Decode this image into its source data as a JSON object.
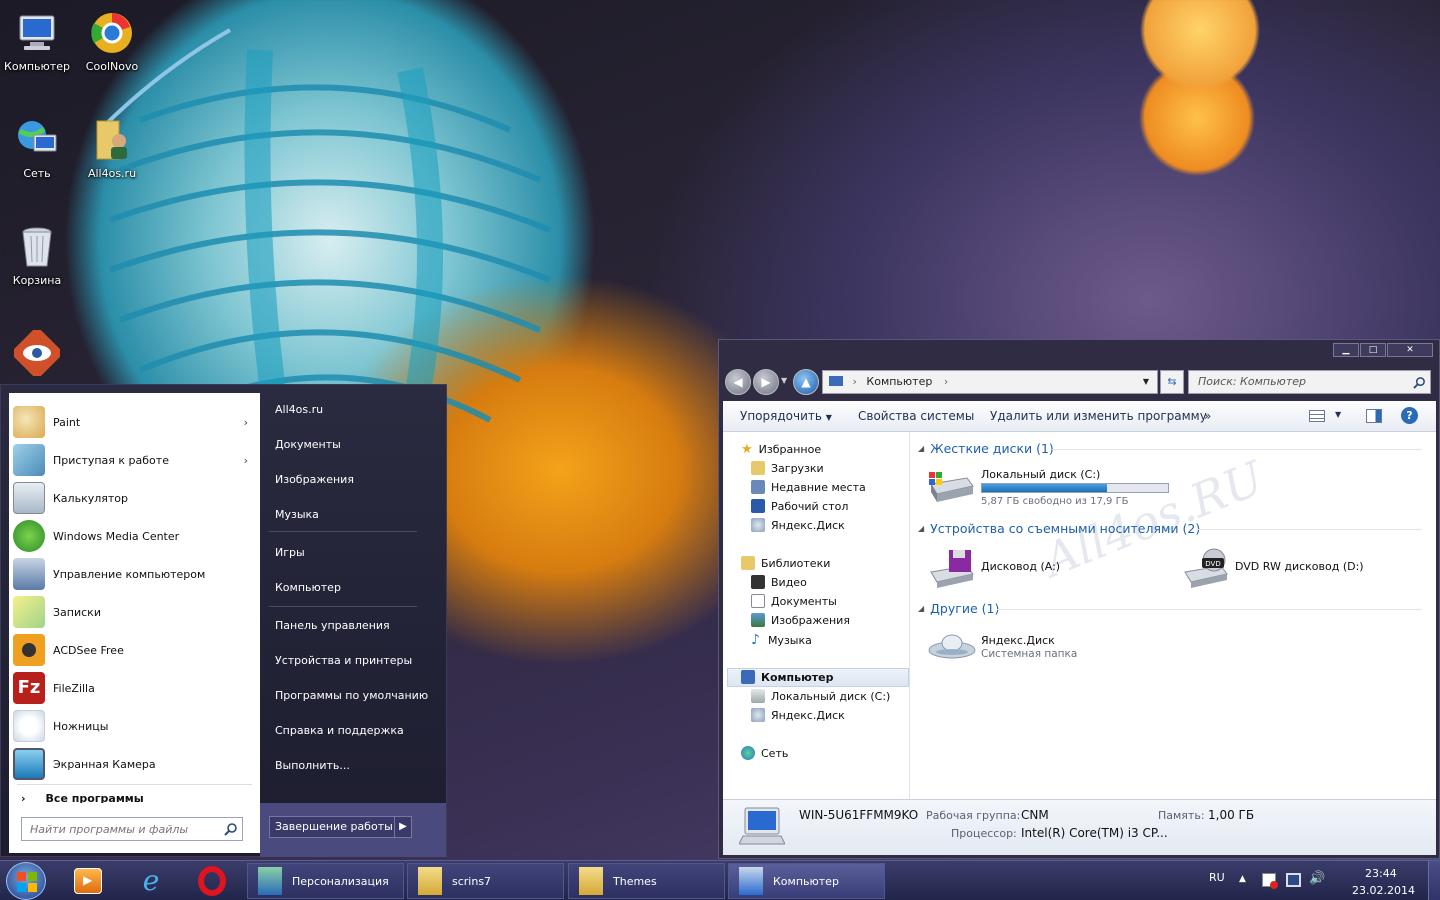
{
  "desktop": {
    "icons": [
      {
        "label": "Компьютер"
      },
      {
        "label": "CoolNovo"
      },
      {
        "label": "Сеть"
      },
      {
        "label": "All4os.ru"
      },
      {
        "label": "Корзина"
      },
      {
        "label": ""
      }
    ]
  },
  "start_menu": {
    "programs": [
      {
        "label": "Paint",
        "arrow": "›"
      },
      {
        "label": "Приступая к работе",
        "arrow": "›"
      },
      {
        "label": "Калькулятор",
        "arrow": ""
      },
      {
        "label": "Windows Media Center",
        "arrow": ""
      },
      {
        "label": "Управление компьютером",
        "arrow": ""
      },
      {
        "label": "Записки",
        "arrow": ""
      },
      {
        "label": "ACDSee Free",
        "arrow": ""
      },
      {
        "label": "FileZilla",
        "arrow": ""
      },
      {
        "label": "Ножницы",
        "arrow": ""
      },
      {
        "label": "Экранная Камера",
        "arrow": ""
      }
    ],
    "all_programs": "Все программы",
    "search_placeholder": "Найти программы и файлы",
    "right": [
      "All4os.ru",
      "Документы",
      "Изображения",
      "Музыка",
      "Игры",
      "Компьютер",
      "Панель управления",
      "Устройства и принтеры",
      "Программы по умолчанию",
      "Справка и поддержка",
      "Выполнить..."
    ],
    "shutdown": "Завершение работы"
  },
  "explorer": {
    "address_crumb": "Компьютер",
    "search_placeholder": "Поиск: Компьютер",
    "toolbar": {
      "organize": "Упорядочить",
      "system_props": "Свойства системы",
      "uninstall": "Удалить или изменить программу",
      "more": "»"
    },
    "nav": {
      "favorites": "Избранное",
      "downloads": "Загрузки",
      "recent": "Недавние места",
      "desktop": "Рабочий стол",
      "yadisk": "Яндекс.Диск",
      "libraries": "Библиотеки",
      "video": "Видео",
      "documents": "Документы",
      "images": "Изображения",
      "music": "Музыка",
      "computer": "Компьютер",
      "local_c": "Локальный диск (C:)",
      "yadisk2": "Яндекс.Диск",
      "network": "Сеть"
    },
    "groups": {
      "hdd": "Жесткие диски (1)",
      "removable": "Устройства со съемными носителями (2)",
      "other": "Другие (1)"
    },
    "drive_c": {
      "name": "Локальный диск (C:)",
      "free": "5,87 ГБ свободно из 17,9 ГБ",
      "used_fraction": 0.67
    },
    "floppy": "Дисковод (A:)",
    "dvd": "DVD RW дисковод (D:)",
    "yadisk": {
      "name": "Яндекс.Диск",
      "sub": "Системная папка"
    },
    "details": {
      "pc_name": "WIN-5U61FFMM9KO",
      "wg_label": "Рабочая группа:",
      "wg_value": "CNM",
      "mem_label": "Память:",
      "mem_value": "1,00 ГБ",
      "cpu_label": "Процессор:",
      "cpu_value": "Intel(R) Core(TM) i3 CP..."
    },
    "watermark": "All4os.RU"
  },
  "taskbar": {
    "windows": [
      "Персонализация",
      "scrins7",
      "Themes",
      "Компьютер"
    ],
    "lang": "RU",
    "time": "23:44",
    "date": "23.02.2014"
  }
}
